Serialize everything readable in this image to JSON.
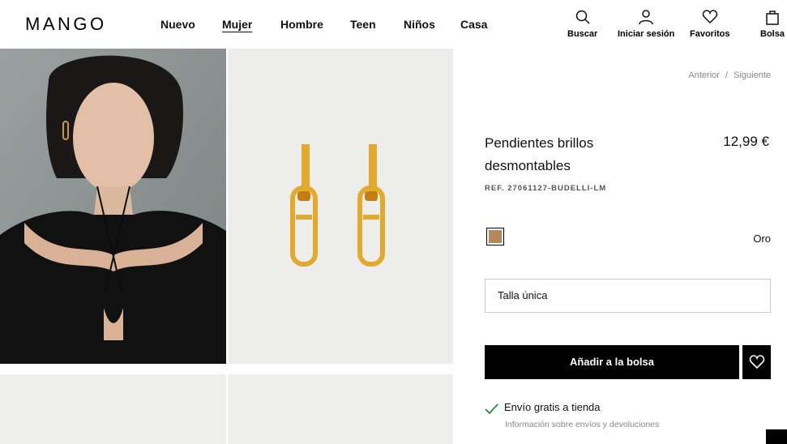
{
  "brand": {
    "logo": "MANGO"
  },
  "nav": {
    "items": [
      "Nuevo",
      "Mujer",
      "Hombre",
      "Teen",
      "Niños",
      "Casa"
    ],
    "active": "Mujer"
  },
  "utility": {
    "search": "Buscar",
    "login": "Iniciar sesión",
    "favorites": "Favoritos",
    "bag": "Bolsa"
  },
  "pager": {
    "prev": "Anterior",
    "sep": "/",
    "next": "Siguiente"
  },
  "product": {
    "title_line1": "Pendientes brillos",
    "title_line2": "desmontables",
    "price": "12,99 €",
    "ref": "REF. 27061127-BUDELLI-LM",
    "color_name": "Oro",
    "size": "Talla única",
    "add_to_bag": "Añadir a la bolsa"
  },
  "shipping": {
    "free": "Envío gratis a tienda",
    "info": "Información sobre envíos y devoluciones"
  },
  "colors": {
    "swatch": "#b58a5a",
    "button": "#000000",
    "check": "#2e8b3a",
    "gold": "#e3a92a"
  },
  "icons": [
    "search-icon",
    "user-icon",
    "heart-icon",
    "bag-icon",
    "check-icon"
  ]
}
